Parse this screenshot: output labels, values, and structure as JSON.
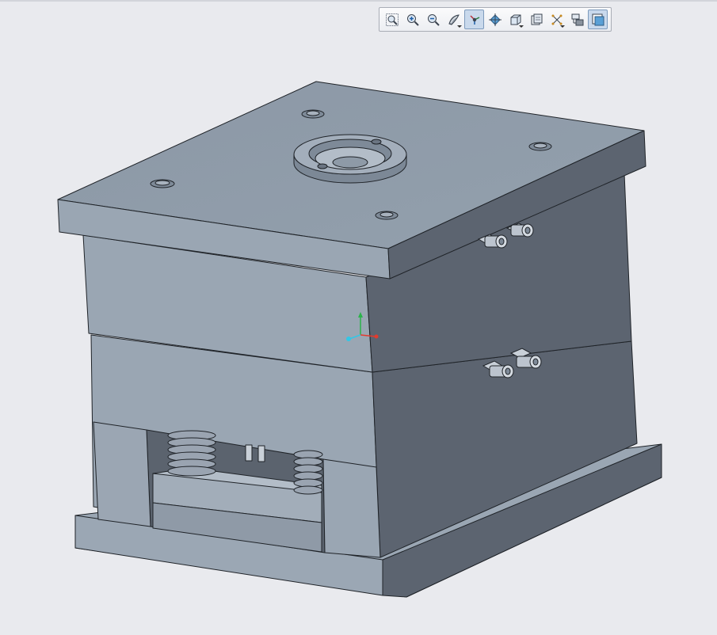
{
  "window": {
    "background": "#e9eaee"
  },
  "toolbar": {
    "buttons": [
      {
        "icon": "zoom-fit-icon",
        "active": false,
        "dropdown": false
      },
      {
        "icon": "zoom-in-icon",
        "active": false,
        "dropdown": false
      },
      {
        "icon": "zoom-out-icon",
        "active": false,
        "dropdown": false
      },
      {
        "icon": "display-style-icon",
        "active": false,
        "dropdown": true
      },
      {
        "icon": "datum-display-icon",
        "active": true,
        "dropdown": false
      },
      {
        "icon": "spin-center-icon",
        "active": false,
        "dropdown": false
      },
      {
        "icon": "saved-views-icon",
        "active": false,
        "dropdown": true
      },
      {
        "icon": "layers-icon",
        "active": false,
        "dropdown": false
      },
      {
        "icon": "annotation-display-icon",
        "active": false,
        "dropdown": true
      },
      {
        "icon": "view-manager-icon",
        "active": false,
        "dropdown": false
      },
      {
        "icon": "appearance-icon",
        "active": true,
        "dropdown": false
      }
    ]
  },
  "model": {
    "name": "injection-mold-assembly",
    "colors": {
      "top_face": "#8e9aa8",
      "front_face": "#9aa5b2",
      "side_face": "#5c6470",
      "edge": "#1f2328",
      "dark": "#4a525c"
    }
  },
  "csys": {
    "x_color": "#e23b2e",
    "y_color": "#2bb34a",
    "z_color": "#33c7e6"
  }
}
